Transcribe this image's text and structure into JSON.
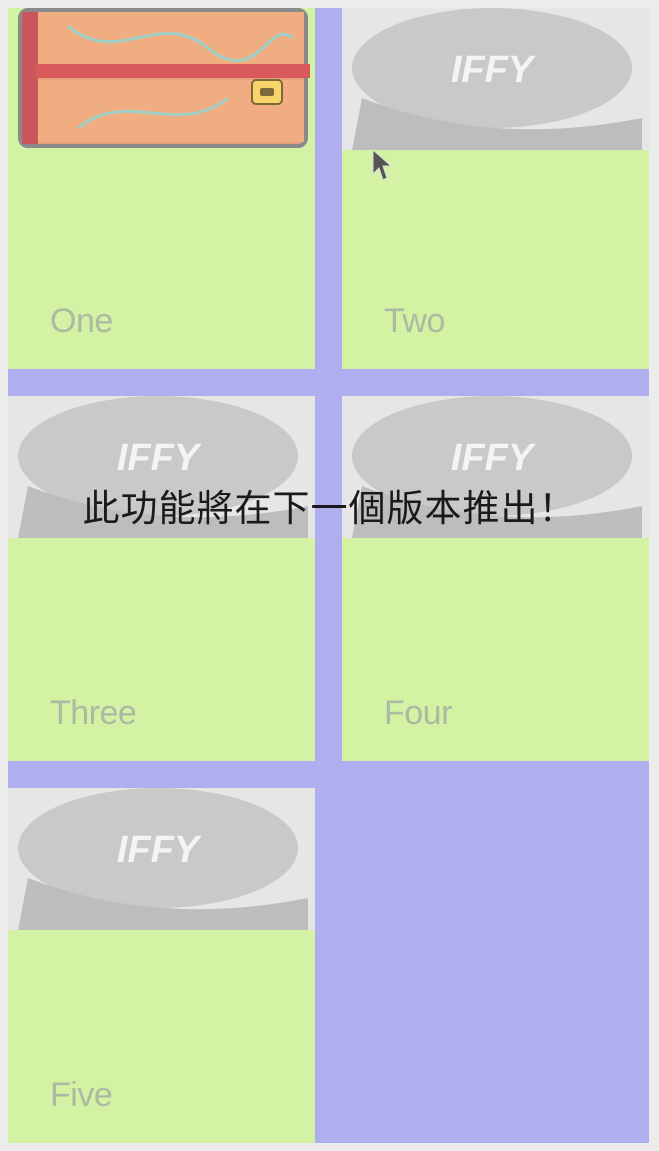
{
  "tiles": [
    {
      "label": "One",
      "image": "wallet-image"
    },
    {
      "label": "Two",
      "image": "cap-image"
    },
    {
      "label": "Three",
      "image": "cap-image"
    },
    {
      "label": "Four",
      "image": "cap-image"
    },
    {
      "label": "Five",
      "image": "cap-image"
    }
  ],
  "cap_text": "IFFY",
  "toast": {
    "message": "此功能將在下一個版本推出！"
  },
  "colors": {
    "background": "#afaeee",
    "tile": "#d3f2a4",
    "caption": "#a9bca3",
    "toast_text": "#1a1a1a"
  }
}
